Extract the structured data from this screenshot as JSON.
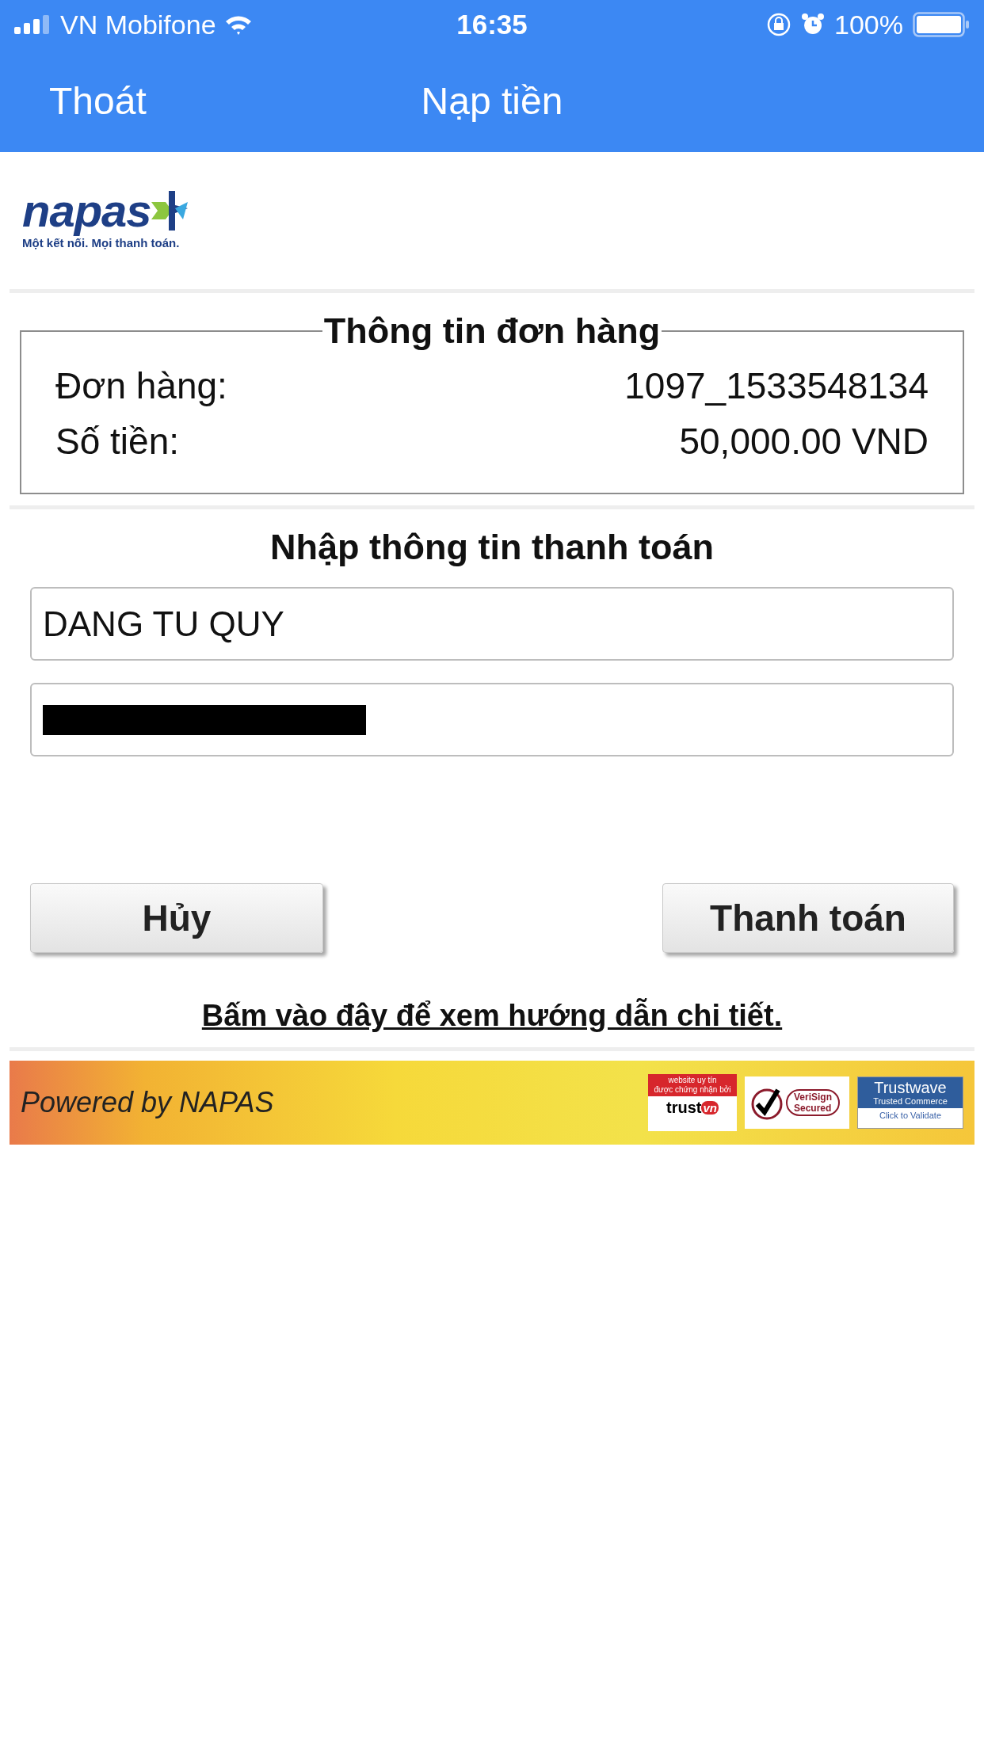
{
  "status_bar": {
    "carrier": "VN Mobifone",
    "time": "16:35",
    "battery": "100%"
  },
  "nav_bar": {
    "back": "Thoát",
    "title": "Nạp tiền"
  },
  "logo": {
    "wordmark": "napas",
    "slogan": "Một kết nối. Mọi thanh toán."
  },
  "order_info": {
    "title": "Thông tin đơn hàng",
    "rows": [
      {
        "label": "Đơn hàng:",
        "value": "1097_1533548134"
      },
      {
        "label": "Số tiền:",
        "value": "50,000.00 VND"
      }
    ]
  },
  "payment": {
    "title": "Nhập thông tin thanh toán",
    "card_name": "DANG TU QUY",
    "card_number_redacted": true
  },
  "buttons": [
    {
      "label": "Hủy",
      "kind": "cancel"
    },
    {
      "label": "Thanh toán",
      "kind": "pay"
    }
  ],
  "help_link": "Bấm vào đây để xem hướng dẫn chi tiết.",
  "footer": {
    "powered_by": "Powered by NAPAS",
    "badges": [
      {
        "kind": "trustvn",
        "texts": [
          "website uy tín",
          "được chứng nhận bởi",
          "trust",
          "vn"
        ]
      },
      {
        "kind": "verisign",
        "texts": [
          "VeriSign",
          "Secured"
        ]
      },
      {
        "kind": "trustwave",
        "texts": [
          "Trustwave",
          "Trusted Commerce",
          "Click to Validate"
        ]
      }
    ]
  }
}
